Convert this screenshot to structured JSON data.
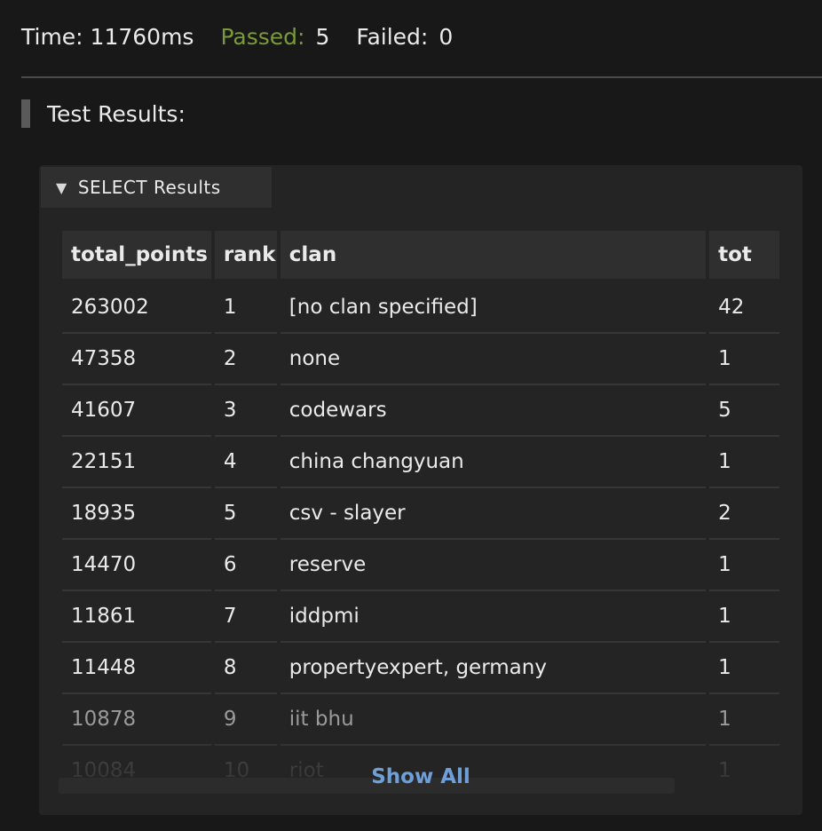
{
  "summary": {
    "time_label": "Time: 11760ms",
    "passed_label": "Passed:",
    "passed_value": "5",
    "failed_label": "Failed:",
    "failed_value": "0"
  },
  "results_heading": "Test Results:",
  "panel": {
    "tab_icon": "▼",
    "tab_label": "SELECT Results",
    "show_all": "Show All"
  },
  "table": {
    "columns": [
      "total_points",
      "rank",
      "clan",
      "tot"
    ],
    "rows": [
      [
        "263002",
        "1",
        "[no clan specified]",
        "42"
      ],
      [
        "47358",
        "2",
        "none",
        "1"
      ],
      [
        "41607",
        "3",
        "codewars",
        "5"
      ],
      [
        "22151",
        "4",
        "china changyuan",
        "1"
      ],
      [
        "18935",
        "5",
        "csv - slayer",
        "2"
      ],
      [
        "14470",
        "6",
        "reserve",
        "1"
      ],
      [
        "11861",
        "7",
        "iddpmi",
        "1"
      ],
      [
        "11448",
        "8",
        "propertyexpert, germany",
        "1"
      ],
      [
        "10878",
        "9",
        "iit bhu",
        "1"
      ],
      [
        "10084",
        "10",
        "riot",
        "1"
      ]
    ]
  },
  "colors": {
    "passed": "#7a9a3a",
    "link": "#6f9fd8",
    "background": "#181818",
    "panel": "#242424"
  }
}
